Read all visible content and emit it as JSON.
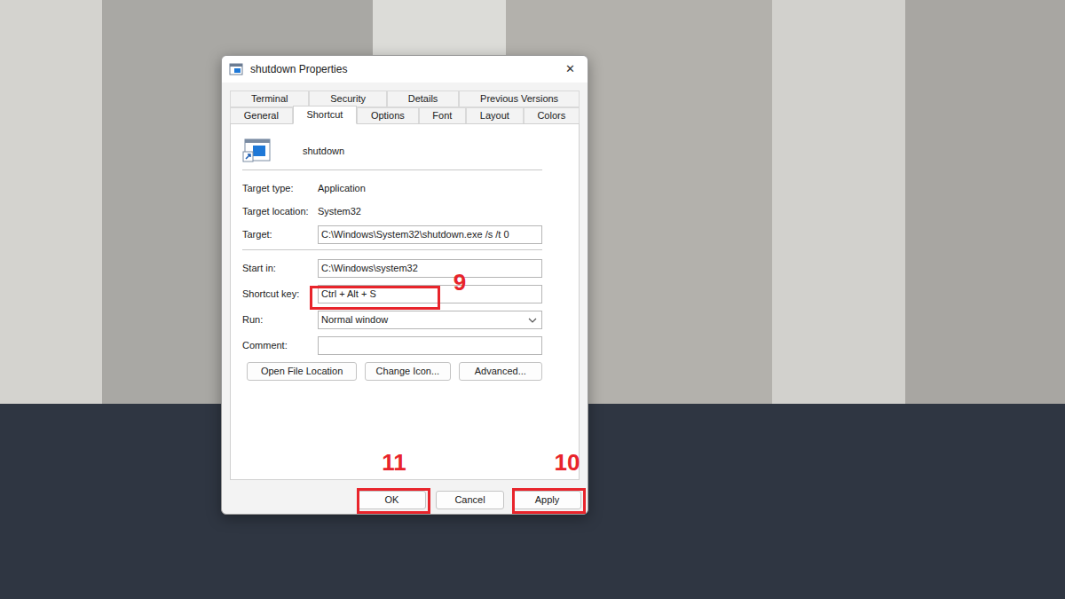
{
  "window": {
    "title": "shutdown Properties",
    "close": "✕"
  },
  "tab_rows": [
    [
      {
        "label": "Terminal",
        "selected": false
      },
      {
        "label": "Security",
        "selected": false
      },
      {
        "label": "Details",
        "selected": false
      },
      {
        "label": "Previous Versions",
        "selected": false
      }
    ],
    [
      {
        "label": "General",
        "selected": false
      },
      {
        "label": "Shortcut",
        "selected": true
      },
      {
        "label": "Options",
        "selected": false
      },
      {
        "label": "Font",
        "selected": false
      },
      {
        "label": "Layout",
        "selected": false
      },
      {
        "label": "Colors",
        "selected": false
      }
    ]
  ],
  "shortcut": {
    "name": "shutdown"
  },
  "field_groups": [
    [
      {
        "kind": "text",
        "label": "Target type:",
        "value": "Application"
      },
      {
        "kind": "text",
        "label": "Target location:",
        "value": "System32"
      },
      {
        "kind": "input",
        "label": "Target:",
        "value": "C:\\Windows\\System32\\shutdown.exe /s /t 0"
      }
    ],
    [
      {
        "kind": "input",
        "label": "Start in:",
        "value": "C:\\Windows\\system32"
      },
      {
        "kind": "input",
        "label": "Shortcut key:",
        "value": "Ctrl + Alt + S"
      },
      {
        "kind": "select",
        "label": "Run:",
        "value": "Normal window"
      },
      {
        "kind": "input",
        "label": "Comment:",
        "value": ""
      }
    ]
  ],
  "action_buttons": [
    "Open File Location",
    "Change Icon...",
    "Advanced..."
  ],
  "buttons": [
    "OK",
    "Cancel",
    "Apply"
  ],
  "annotations": [
    {
      "label": "9"
    },
    {
      "label": "10"
    },
    {
      "label": "11"
    }
  ]
}
